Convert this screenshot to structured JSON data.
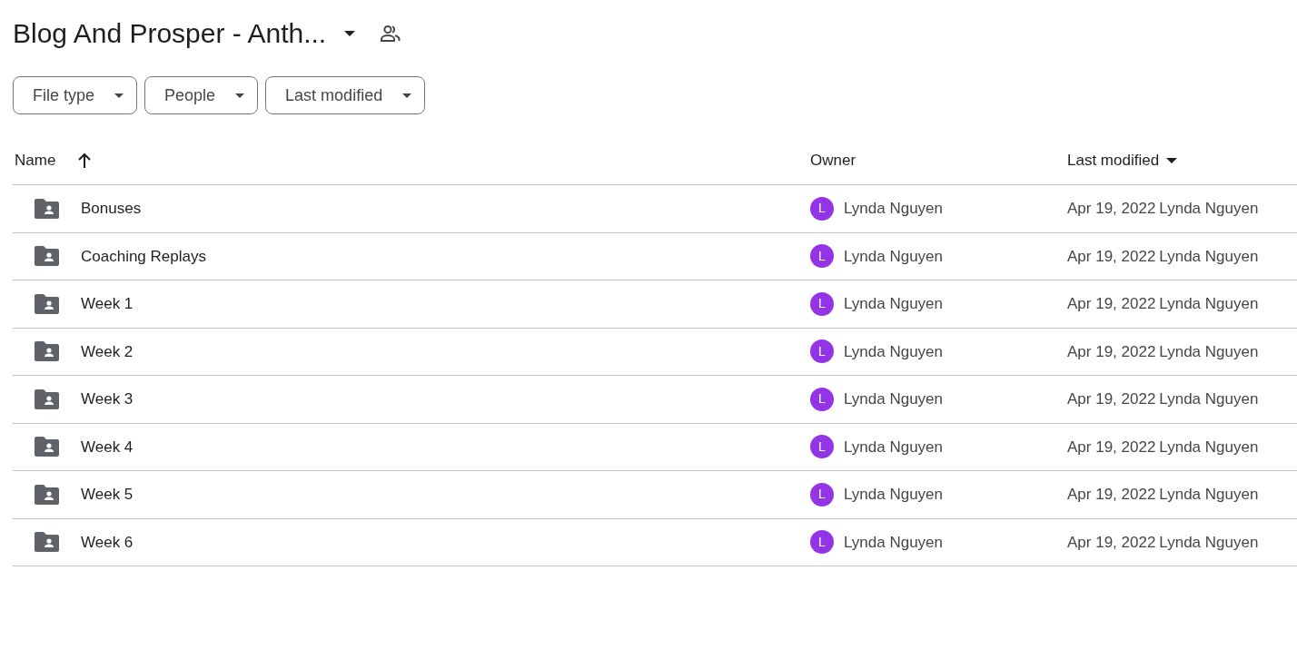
{
  "header": {
    "title": "Blog And Prosper - Anth...",
    "shared": true
  },
  "filters": [
    {
      "label": "File type"
    },
    {
      "label": "People"
    },
    {
      "label": "Last modified"
    }
  ],
  "table": {
    "columns": [
      {
        "label": "Name",
        "sorted": true,
        "menu": false
      },
      {
        "label": "Owner"
      },
      {
        "label": "Last modified",
        "sorted": false,
        "menu": true
      }
    ],
    "rows": [
      {
        "name": "Bonuses",
        "owner": "Lynda Nguyen",
        "avatar_letter": "L",
        "modified_date": "Apr 19, 2022",
        "modified_by": "Lynda Nguyen"
      },
      {
        "name": "Coaching Replays",
        "owner": "Lynda Nguyen",
        "avatar_letter": "L",
        "modified_date": "Apr 19, 2022",
        "modified_by": "Lynda Nguyen"
      },
      {
        "name": "Week 1",
        "owner": "Lynda Nguyen",
        "avatar_letter": "L",
        "modified_date": "Apr 19, 2022",
        "modified_by": "Lynda Nguyen"
      },
      {
        "name": "Week 2",
        "owner": "Lynda Nguyen",
        "avatar_letter": "L",
        "modified_date": "Apr 19, 2022",
        "modified_by": "Lynda Nguyen"
      },
      {
        "name": "Week 3",
        "owner": "Lynda Nguyen",
        "avatar_letter": "L",
        "modified_date": "Apr 19, 2022",
        "modified_by": "Lynda Nguyen"
      },
      {
        "name": "Week 4",
        "owner": "Lynda Nguyen",
        "avatar_letter": "L",
        "modified_date": "Apr 19, 2022",
        "modified_by": "Lynda Nguyen"
      },
      {
        "name": "Week 5",
        "owner": "Lynda Nguyen",
        "avatar_letter": "L",
        "modified_date": "Apr 19, 2022",
        "modified_by": "Lynda Nguyen"
      },
      {
        "name": "Week 6",
        "owner": "Lynda Nguyen",
        "avatar_letter": "L",
        "modified_date": "Apr 19, 2022",
        "modified_by": "Lynda Nguyen"
      }
    ]
  }
}
